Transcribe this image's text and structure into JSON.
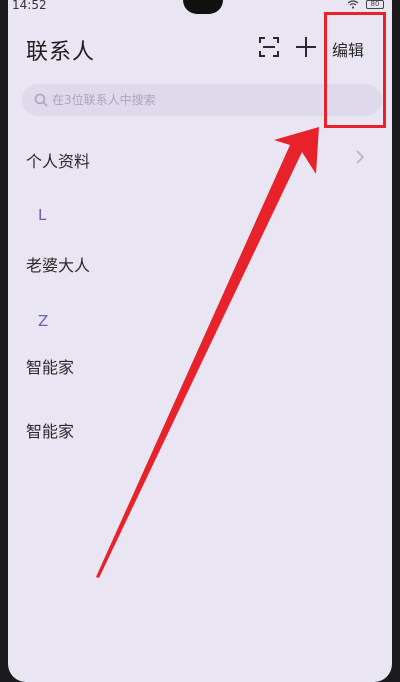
{
  "status_bar": {
    "time": "14:52",
    "battery_level": "80"
  },
  "header": {
    "title": "联系人",
    "edit_label": "编辑"
  },
  "search": {
    "placeholder": "在3位联系人中搜索"
  },
  "profile": {
    "label": "个人资料"
  },
  "sections": [
    {
      "letter": "L",
      "contacts": [
        "老婆大人"
      ]
    },
    {
      "letter": "Z",
      "contacts": [
        "智能家",
        "智能家"
      ]
    }
  ],
  "icons": {
    "scan": "scan-icon",
    "add": "add-icon",
    "search": "search-icon",
    "chevron": "chevron-right-icon"
  },
  "colors": {
    "annotation": "#e8222a",
    "section_letter": "#6b5fb0",
    "background": "#e9e5f3"
  }
}
